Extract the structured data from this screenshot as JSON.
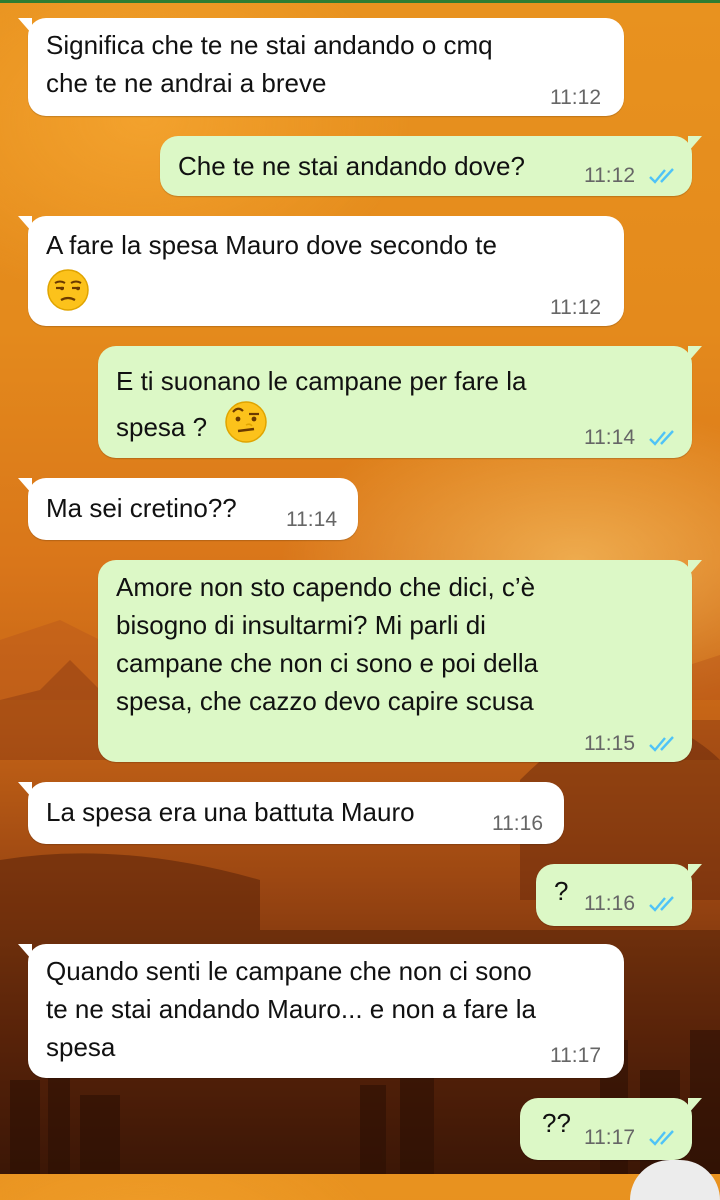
{
  "messages": [
    {
      "dir": "in",
      "text": "Significa che te ne stai andando o cmq\nche te ne andrai a breve",
      "time": "11:12"
    },
    {
      "dir": "out",
      "text": "Che te ne stai andando dove?",
      "time": "11:12",
      "status": "read"
    },
    {
      "dir": "in",
      "text": "A fare la spesa Mauro dove secondo te",
      "emoji": "unamused-face-icon",
      "time": "11:12"
    },
    {
      "dir": "out",
      "text": "E ti suonano le campane per fare la\nspesa ?",
      "emoji": "raised-eyebrow-face-icon",
      "time": "11:14",
      "status": "read"
    },
    {
      "dir": "in",
      "text": "Ma sei cretino??",
      "time": "11:14"
    },
    {
      "dir": "out",
      "text": "Amore non sto capendo che dici, c’è\nbisogno di insultarmi? Mi parli di\ncampane che non ci sono e poi della\nspesa, che cazzo devo capire scusa",
      "time": "11:15",
      "status": "read"
    },
    {
      "dir": "in",
      "text": "La spesa era una battuta Mauro",
      "time": "11:16"
    },
    {
      "dir": "out",
      "text": "?",
      "time": "11:16",
      "status": "read"
    },
    {
      "dir": "in",
      "text": "Quando senti le campane che non ci sono\nte ne stai andando Mauro... e non a fare la\nspesa",
      "time": "11:17"
    },
    {
      "dir": "out",
      "text": "??",
      "time": "11:17",
      "status": "read"
    }
  ],
  "colors": {
    "incoming_bubble": "#ffffff",
    "outgoing_bubble": "#dcf8c6",
    "read_ticks": "#4fc3f7",
    "timestamp": "#666666"
  }
}
